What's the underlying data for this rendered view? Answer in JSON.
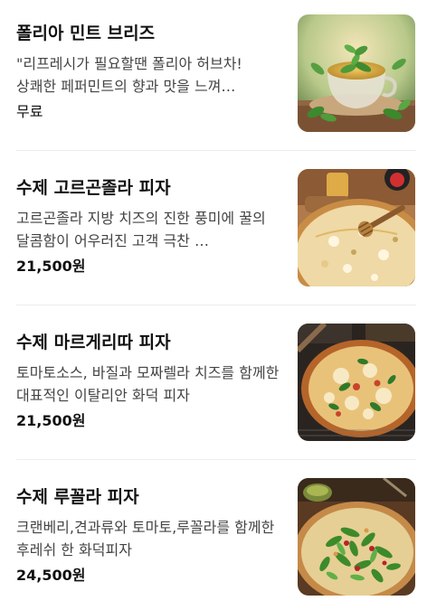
{
  "menu": {
    "items": [
      {
        "name": "폴리아 민트 브리즈",
        "description": "\"리프레시가 필요할땐 폴리아 허브차! 상쾌한 페퍼민트의 향과 맛을 느껴…",
        "price": "무료",
        "image": "mint-tea-photo"
      },
      {
        "name": "수제 고르곤졸라 피자",
        "description": "고르곤졸라 지방 치즈의 진한 풍미에 꿀의 달콤함이 어우러진 고객 극찬 …",
        "price": "21,500원",
        "image": "gorgonzola-pizza-photo"
      },
      {
        "name": "수제 마르게리따 피자",
        "description": "토마토소스, 바질과 모짜렐라 치즈를 함께한 대표적인 이탈리안 화덕 피자",
        "price": "21,500원",
        "image": "margherita-pizza-photo"
      },
      {
        "name": "수제 루꼴라 피자",
        "description": "크랜베리,견과류와 토마토,루꼴라를 함께한 후레쉬 한 화덕피자",
        "price": "24,500원",
        "image": "arugula-pizza-photo"
      }
    ]
  }
}
